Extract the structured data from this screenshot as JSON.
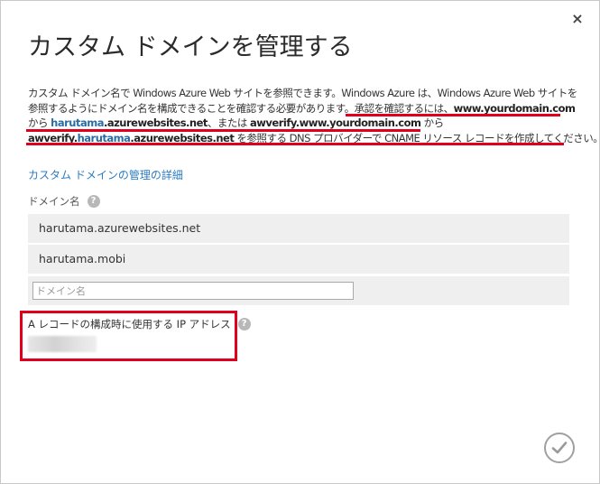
{
  "dialog": {
    "title": "カスタム ドメインを管理する",
    "close_label": "×"
  },
  "description": {
    "line1": "カスタム ドメイン名で Windows Azure Web サイトを参照できます。Windows Azure は、Windows Azure Web サイトを",
    "line2_a": "参照するようにドメイン名を構成できることを確認する必要があります。",
    "line2_b": "承認を確認するには、",
    "line2_c": "www.yourdomain.com",
    "line3_a": "から ",
    "line3_b": "harutama",
    "line3_c": ".azurewebsites.net",
    "line3_d": "、または ",
    "line3_e": "awverify.www.yourdomain.com",
    "line3_f": " から",
    "line4_a": "awverify.",
    "line4_b": "harutama",
    "line4_c": ".azurewebsites.net",
    "line4_d": " を参照する DNS プロバイダーで CNAME リソース レコードを作成してください。"
  },
  "link_details": "カスタム ドメインの管理の詳細",
  "domain_section": {
    "label": "ドメイン名",
    "help_icon": "?",
    "domains": [
      "harutama.azurewebsites.net",
      "harutama.mobi"
    ],
    "input_placeholder": "ドメイン名",
    "input_value": ""
  },
  "ip_section": {
    "label": "A レコードの構成時に使用する IP アドレス",
    "help_icon": "?"
  },
  "colors": {
    "accent_link": "#2b7bc0",
    "highlight_red": "#e0001b",
    "row_background": "#efefef"
  },
  "icons": {
    "close": "close-icon",
    "help": "help-icon",
    "confirm": "checkmark-icon"
  }
}
